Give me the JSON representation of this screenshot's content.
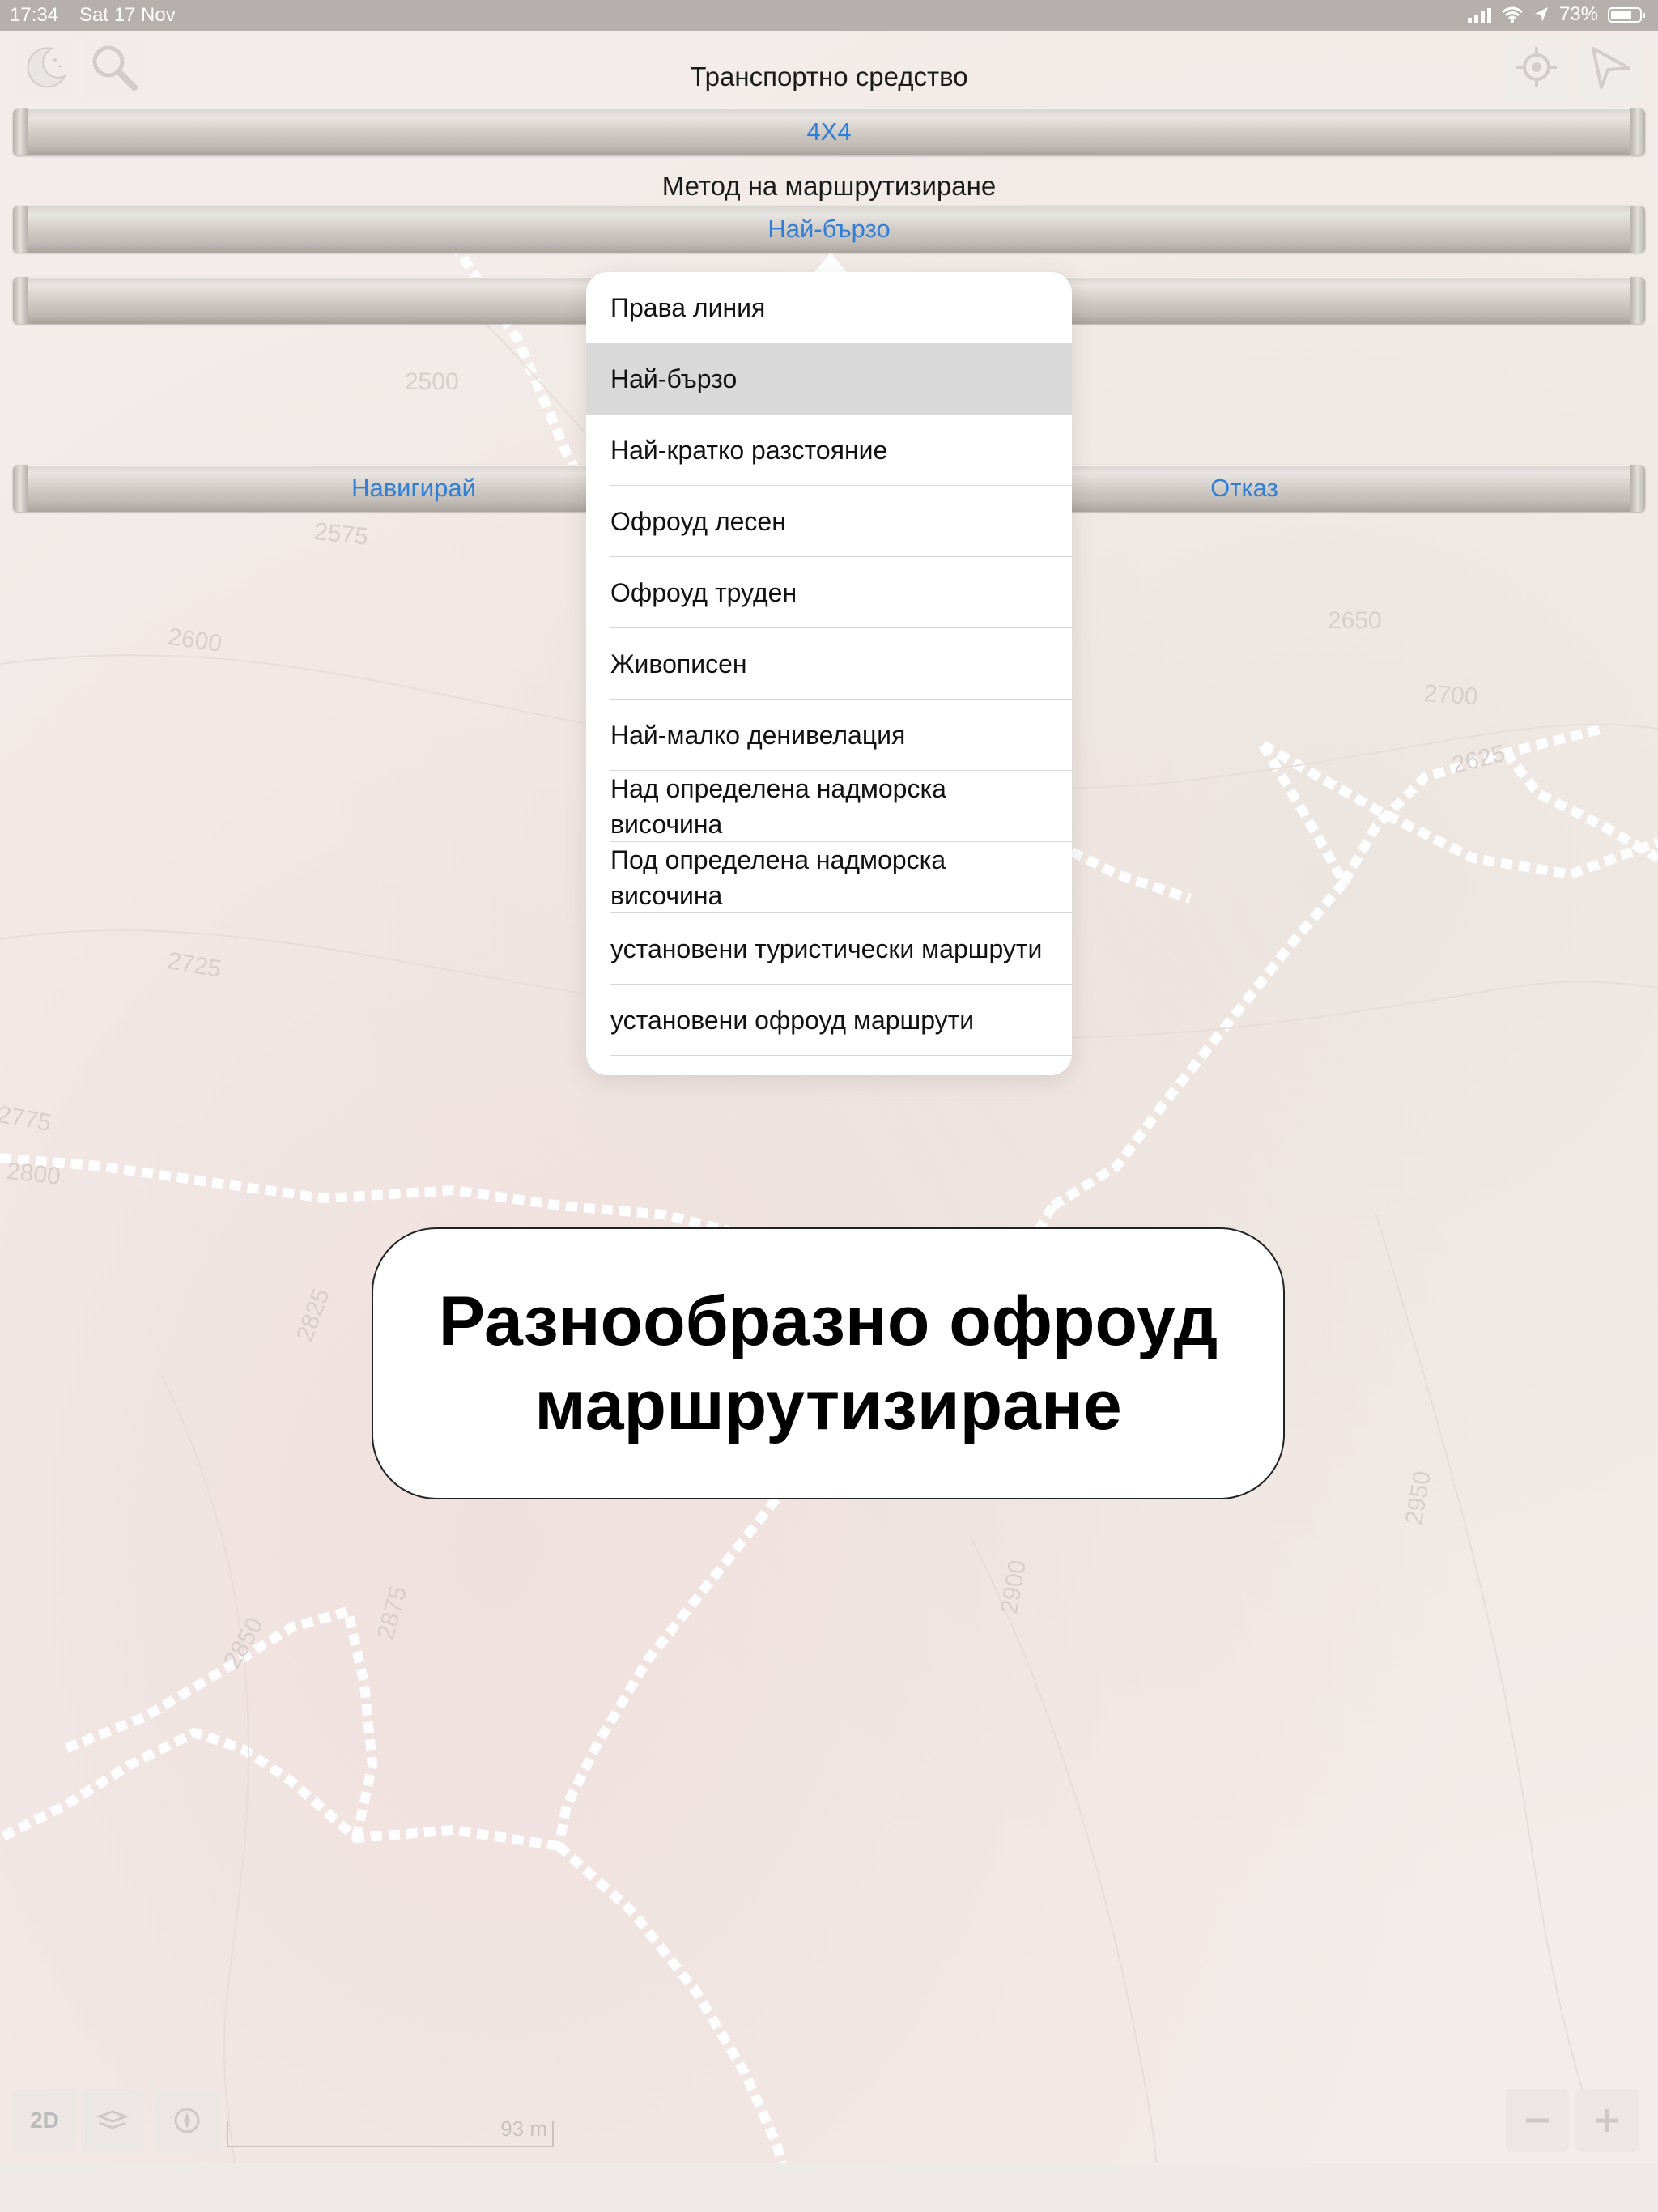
{
  "status_bar": {
    "time": "17:34",
    "date": "Sat 17 Nov",
    "battery": "73%",
    "battery_level": 0.73
  },
  "toolbar": {
    "left_icons": [
      "night-mode-icon",
      "search-icon"
    ],
    "right_icons": [
      "locate-icon",
      "navigate-arrow-icon"
    ]
  },
  "form": {
    "vehicle_label": "Транспортно средство",
    "vehicle_value": "4X4",
    "routing_label": "Метод на маршрутизиране",
    "routing_value": "Най-бързо",
    "navigate_button": "Навигирай",
    "cancel_button": "Отказ"
  },
  "routing_options": {
    "selected_index": 1,
    "items": [
      "Права линия",
      "Най-бързо",
      "Най-кратко разстояние",
      "Офроуд лесен",
      "Офроуд труден",
      "Живописен",
      "Най-малко денивелация",
      "Над определена надморска височина",
      "Под определена надморска височина",
      "установени туристически маршрути",
      "установени офроуд маршрути"
    ]
  },
  "caption": {
    "line1": "Разнообразно офроуд",
    "line2": "маршрутизиране"
  },
  "map": {
    "contour_labels": [
      "2500",
      "2575",
      "2600",
      "2625",
      "2650",
      "2700",
      "2725",
      "2775",
      "2800",
      "2825",
      "2850",
      "2875",
      "2900",
      "2950"
    ],
    "scale_label": "93 m",
    "view_mode": "2D"
  },
  "colors": {
    "link_blue": "#2f7ed8",
    "status_bar": "#b5b0ae",
    "map_background": "#f3ecea"
  }
}
